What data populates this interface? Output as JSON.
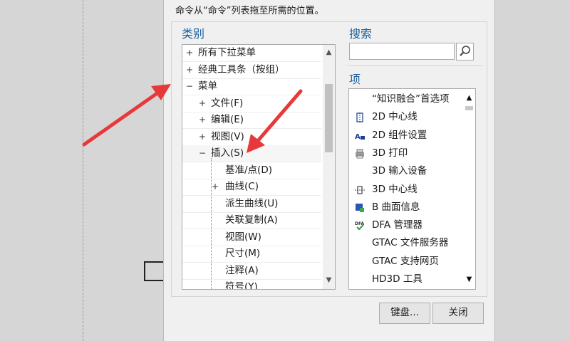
{
  "dialog": {
    "instruction": "命令从“命令”列表拖至所需的位置。",
    "category_title": "类别",
    "search_title": "搜索",
    "search_placeholder": "",
    "items_title": "项",
    "keyboard_button": "键盘...",
    "close_button": "关闭"
  },
  "tree": [
    {
      "label": "所有下拉菜单",
      "expander": "+",
      "level": 0
    },
    {
      "label": "经典工具条（按组）",
      "expander": "+",
      "level": 0
    },
    {
      "label": "菜单",
      "expander": "−",
      "level": 0
    },
    {
      "label": "文件(F)",
      "expander": "+",
      "level": 1
    },
    {
      "label": "编辑(E)",
      "expander": "+",
      "level": 1
    },
    {
      "label": "视图(V)",
      "expander": "+",
      "level": 1
    },
    {
      "label": "插入(S)",
      "expander": "−",
      "level": 1
    },
    {
      "label": "基准/点(D)",
      "expander": "",
      "level": 2
    },
    {
      "label": "曲线(C)",
      "expander": "+",
      "level": 2
    },
    {
      "label": "派生曲线(U)",
      "expander": "",
      "level": 2
    },
    {
      "label": "关联复制(A)",
      "expander": "",
      "level": 2
    },
    {
      "label": "视图(W)",
      "expander": "",
      "level": 2
    },
    {
      "label": "尺寸(M)",
      "expander": "",
      "level": 2
    },
    {
      "label": "注释(A)",
      "expander": "",
      "level": 2
    },
    {
      "label": "符号(Y)",
      "expander": "",
      "level": 2
    }
  ],
  "items": [
    {
      "label": "“知识融合”首选项",
      "icon": "none"
    },
    {
      "label": "2D 中心线",
      "icon": "centerline-2d-icon"
    },
    {
      "label": "2D 组件设置",
      "icon": "component-2d-icon"
    },
    {
      "label": "3D 打印",
      "icon": "printer-3d-icon"
    },
    {
      "label": "3D 输入设备",
      "icon": "none"
    },
    {
      "label": "3D 中心线",
      "icon": "centerline-3d-icon"
    },
    {
      "label": "B 曲面信息",
      "icon": "bsurface-info-icon"
    },
    {
      "label": "DFA 管理器",
      "icon": "dfa-manager-icon"
    },
    {
      "label": "GTAC 文件服务器",
      "icon": "none"
    },
    {
      "label": "GTAC 支持网页",
      "icon": "none"
    },
    {
      "label": "HD3D 工具",
      "icon": "none"
    }
  ],
  "colors": {
    "title": "#1f5f9f",
    "annotation_arrow": "#e8393a"
  }
}
